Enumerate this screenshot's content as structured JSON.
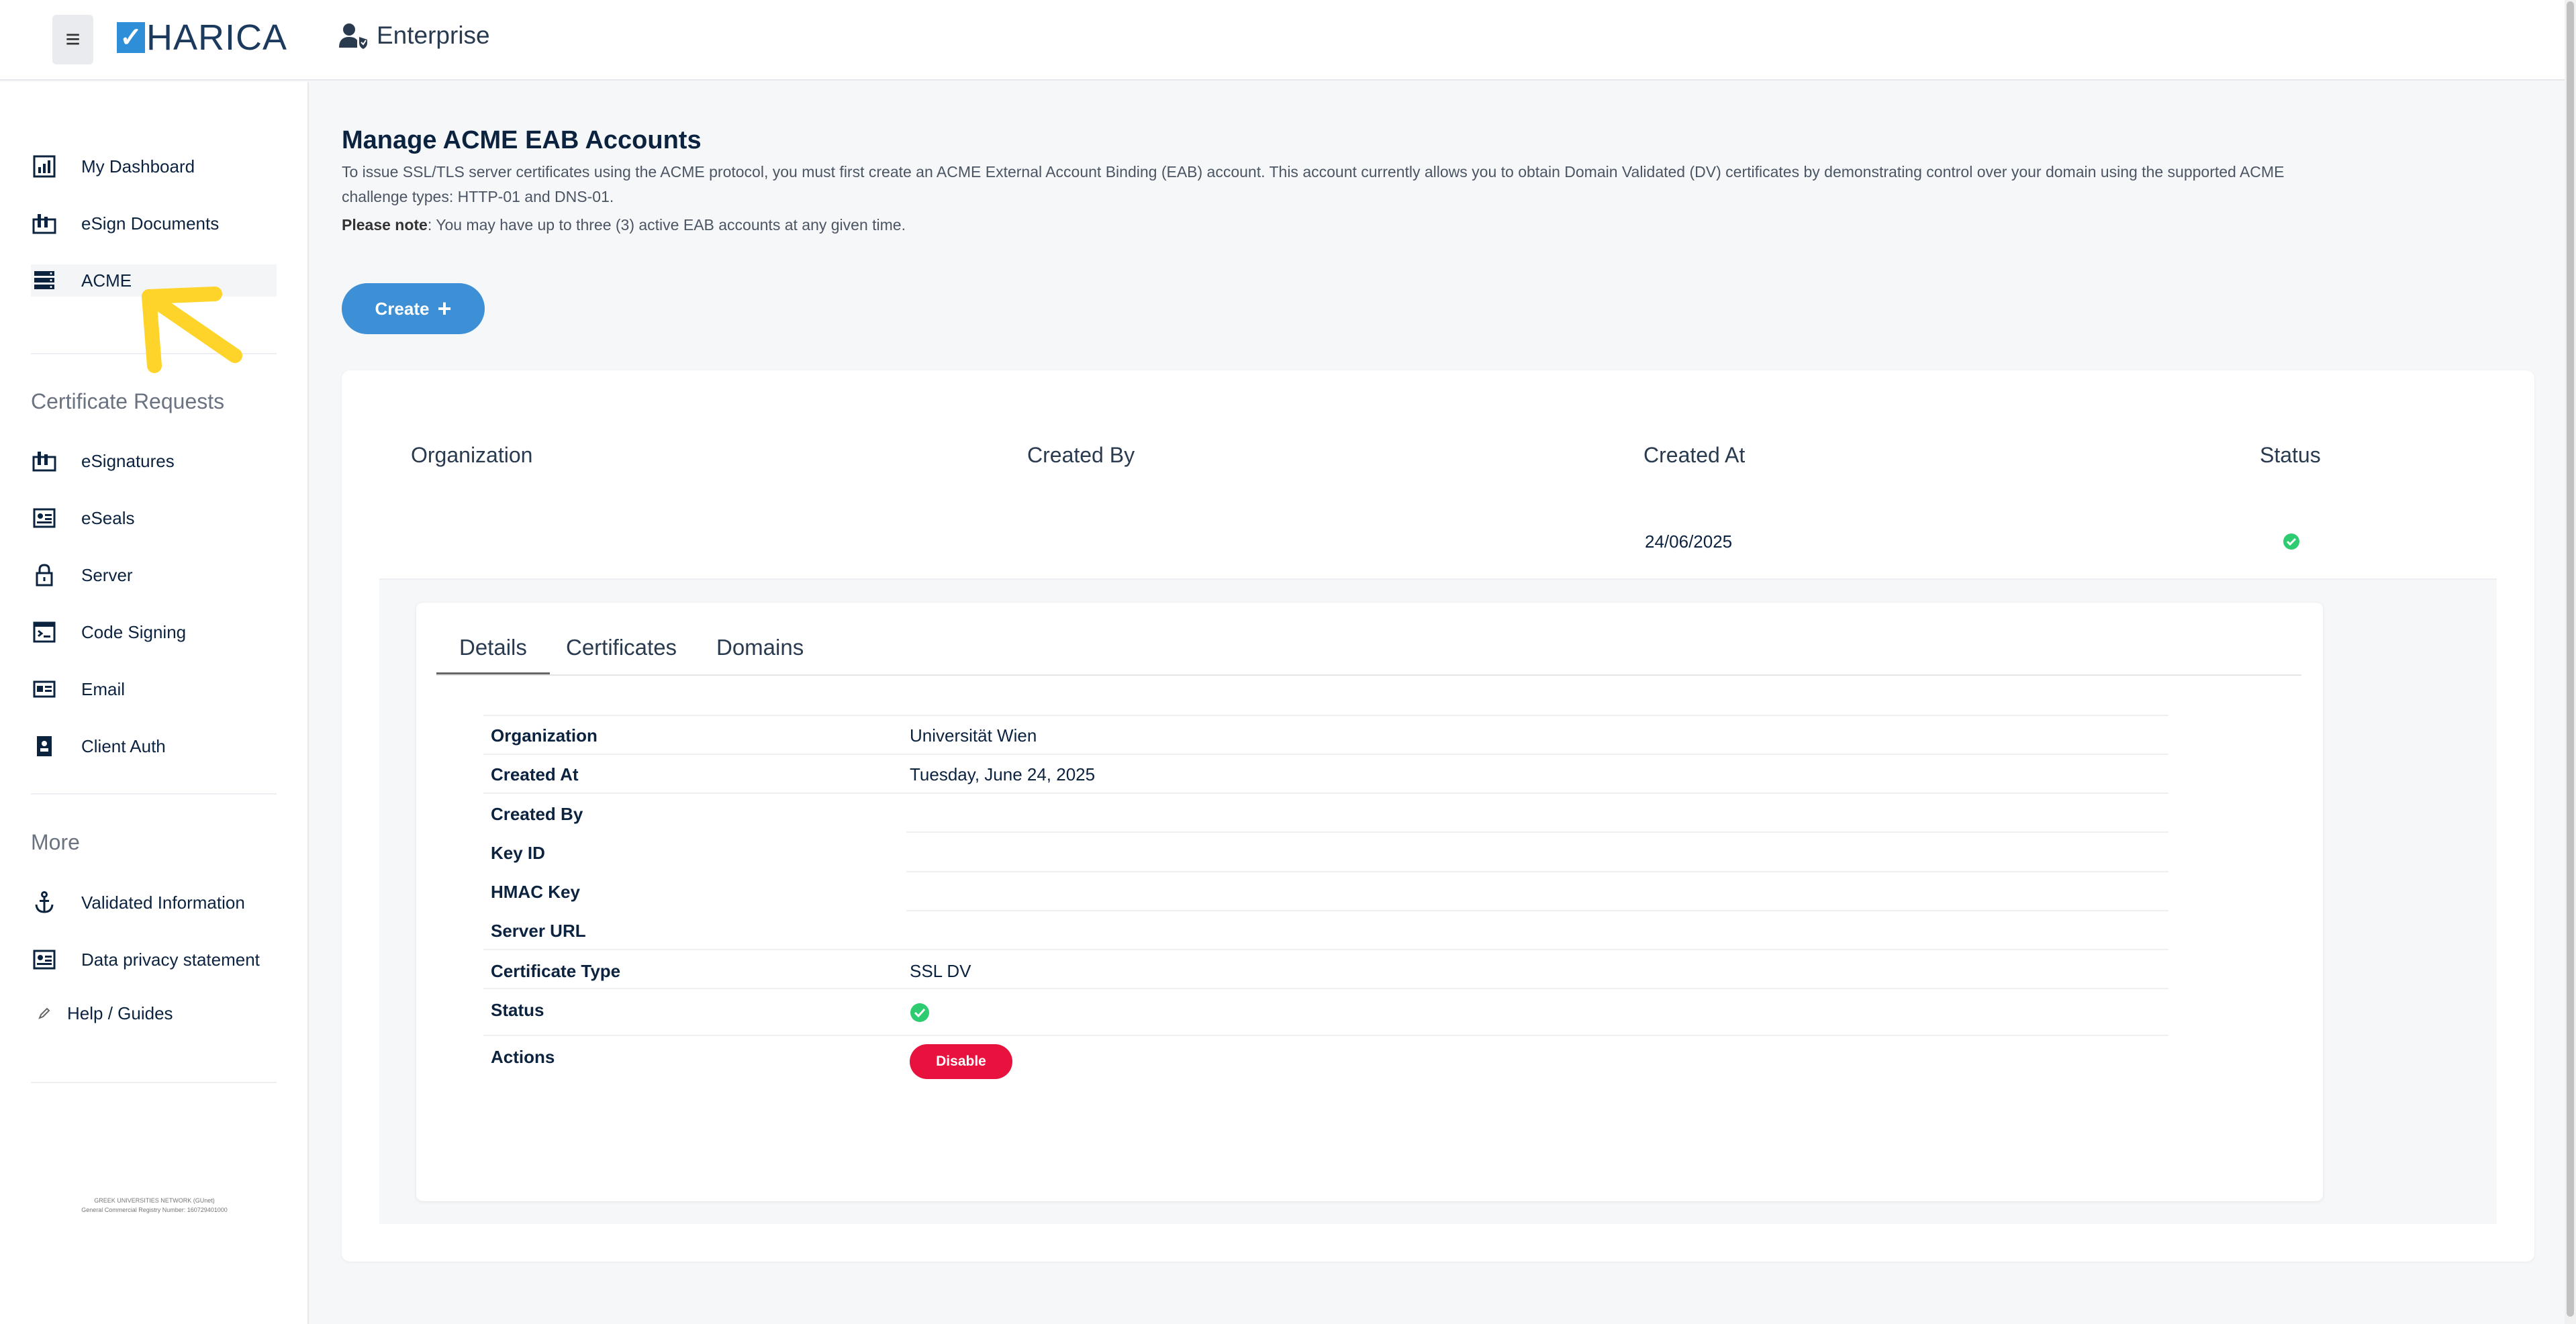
{
  "header": {
    "menu_icon": "hamburger-icon",
    "logo_text": "HARICA",
    "context": "Enterprise"
  },
  "sidebar": {
    "items": [
      {
        "label": "My Dashboard",
        "icon": "dashboard-icon"
      },
      {
        "label": "eSign Documents",
        "icon": "esign-icon"
      },
      {
        "label": "ACME",
        "icon": "server-stack-icon",
        "active": true
      }
    ],
    "section_requests": "Certificate Requests",
    "requests": [
      {
        "label": "eSignatures",
        "icon": "esign-icon"
      },
      {
        "label": "eSeals",
        "icon": "id-card-icon"
      },
      {
        "label": "Server",
        "icon": "lock-icon"
      },
      {
        "label": "Code Signing",
        "icon": "terminal-icon"
      },
      {
        "label": "Email",
        "icon": "email-card-icon"
      },
      {
        "label": "Client Auth",
        "icon": "badge-icon"
      }
    ],
    "section_more": "More",
    "more": [
      {
        "label": "Validated Information",
        "icon": "anchor-icon"
      },
      {
        "label": "Data privacy statement",
        "icon": "id-card-icon"
      },
      {
        "label": "Help / Guides",
        "icon": "pencil-icon"
      }
    ],
    "footer_line1": "GREEK UNIVERSITIES NETWORK (GUnet)",
    "footer_line2": "General Commercial Registry Number: 160729401000"
  },
  "main": {
    "title": "Manage ACME EAB Accounts",
    "description": "To issue SSL/TLS server certificates using the ACME protocol, you must first create an ACME External Account Binding (EAB) account. This account currently allows you to obtain Domain Validated (DV) certificates by demonstrating control over your domain using the supported ACME challenge types: HTTP-01 and DNS-01.",
    "note_bold": "Please note",
    "note_text": ": You may have up to three (3) active EAB accounts at any given time.",
    "create_label": "Create",
    "table": {
      "columns": [
        "Organization",
        "Created By",
        "Created At",
        "Status"
      ],
      "row": {
        "organization": "",
        "created_by": "",
        "created_at": "24/06/2025",
        "status": "active"
      }
    },
    "tabs": [
      "Details",
      "Certificates",
      "Domains"
    ],
    "details": [
      {
        "label": "Organization",
        "value": "Universität Wien"
      },
      {
        "label": "Created At",
        "value": "Tuesday, June 24, 2025"
      },
      {
        "label": "Created By",
        "value": ""
      },
      {
        "label": "Key ID",
        "value": ""
      },
      {
        "label": "HMAC Key",
        "value": ""
      },
      {
        "label": "Server URL",
        "value": ""
      },
      {
        "label": "Certificate Type",
        "value": "SSL DV"
      },
      {
        "label": "Status",
        "value": ""
      },
      {
        "label": "Actions",
        "value": ""
      }
    ],
    "disable_label": "Disable"
  },
  "colors": {
    "accent": "#3d8fd6",
    "danger": "#e8123e",
    "success": "#2ecc71",
    "annotation_arrow": "#ffd42a"
  }
}
